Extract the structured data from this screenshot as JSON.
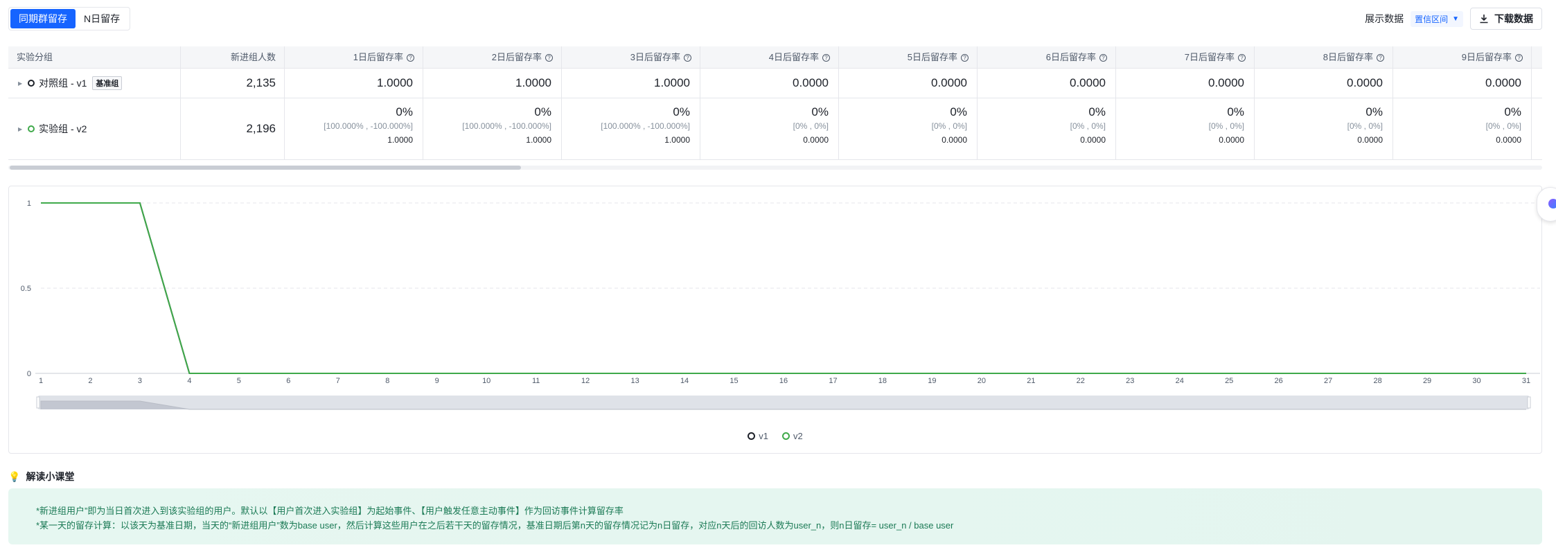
{
  "toolbar": {
    "tabs": [
      "同期群留存",
      "N日留存"
    ],
    "active_tab": 0,
    "show_label": "展示数据",
    "ci_select": "置信区间",
    "download": "下载数据"
  },
  "table": {
    "headers": {
      "group": "实验分组",
      "new_users": "新进组人数",
      "days": [
        "1日后留存率",
        "2日后留存率",
        "3日后留存率",
        "4日后留存率",
        "5日后留存率",
        "6日后留存率",
        "7日后留存率",
        "8日后留存率",
        "9日后留存率"
      ]
    },
    "rows": [
      {
        "name": "对照组 - v1",
        "tag": "基准组",
        "new_users": "2,135",
        "values": [
          "1.0000",
          "1.0000",
          "1.0000",
          "0.0000",
          "0.0000",
          "0.0000",
          "0.0000",
          "0.0000",
          "0.0000"
        ]
      },
      {
        "name": "实验组 - v2",
        "new_users": "2,196",
        "cells": [
          {
            "pct": "0%",
            "ci": "[100.000% , -100.000%]",
            "val": "1.0000"
          },
          {
            "pct": "0%",
            "ci": "[100.000% , -100.000%]",
            "val": "1.0000"
          },
          {
            "pct": "0%",
            "ci": "[100.000% , -100.000%]",
            "val": "1.0000"
          },
          {
            "pct": "0%",
            "ci": "[0% , 0%]",
            "val": "0.0000"
          },
          {
            "pct": "0%",
            "ci": "[0% , 0%]",
            "val": "0.0000"
          },
          {
            "pct": "0%",
            "ci": "[0% , 0%]",
            "val": "0.0000"
          },
          {
            "pct": "0%",
            "ci": "[0% , 0%]",
            "val": "0.0000"
          },
          {
            "pct": "0%",
            "ci": "[0% , 0%]",
            "val": "0.0000"
          },
          {
            "pct": "0%",
            "ci": "[0% , 0%]",
            "val": "0.0000"
          }
        ]
      }
    ]
  },
  "chart_data": {
    "type": "line",
    "x": [
      1,
      2,
      3,
      4,
      5,
      6,
      7,
      8,
      9,
      10,
      11,
      12,
      13,
      14,
      15,
      16,
      17,
      18,
      19,
      20,
      21,
      22,
      23,
      24,
      25,
      26,
      27,
      28,
      29,
      30,
      31
    ],
    "yticks": [
      "0",
      "0.5",
      "1"
    ],
    "ylim": [
      0,
      1
    ],
    "grid": true,
    "series": [
      {
        "name": "v1",
        "color": "#1d2129",
        "values": [
          1,
          1,
          1,
          0,
          0,
          0,
          0,
          0,
          0,
          0,
          0,
          0,
          0,
          0,
          0,
          0,
          0,
          0,
          0,
          0,
          0,
          0,
          0,
          0,
          0,
          0,
          0,
          0,
          0,
          0,
          0
        ]
      },
      {
        "name": "v2",
        "color": "#3fa94a",
        "values": [
          1,
          1,
          1,
          0,
          0,
          0,
          0,
          0,
          0,
          0,
          0,
          0,
          0,
          0,
          0,
          0,
          0,
          0,
          0,
          0,
          0,
          0,
          0,
          0,
          0,
          0,
          0,
          0,
          0,
          0,
          0
        ]
      }
    ],
    "legend": "bottom-center"
  },
  "tips": {
    "title": "解读小课堂",
    "lines": [
      "*新进组用户”即为当日首次进入到该实验组的用户。默认以【用户首次进入实验组】为起始事件、【用户触发任意主动事件】作为回访事件计算留存率",
      "*某一天的留存计算：以该天为基准日期，当天的“新进组用户”数为base user，然后计算这些用户在之后若干天的留存情况，基准日期后第n天的留存情况记为n日留存，对应n天后的回访人数为user_n，则n日留存= user_n / base user"
    ]
  }
}
